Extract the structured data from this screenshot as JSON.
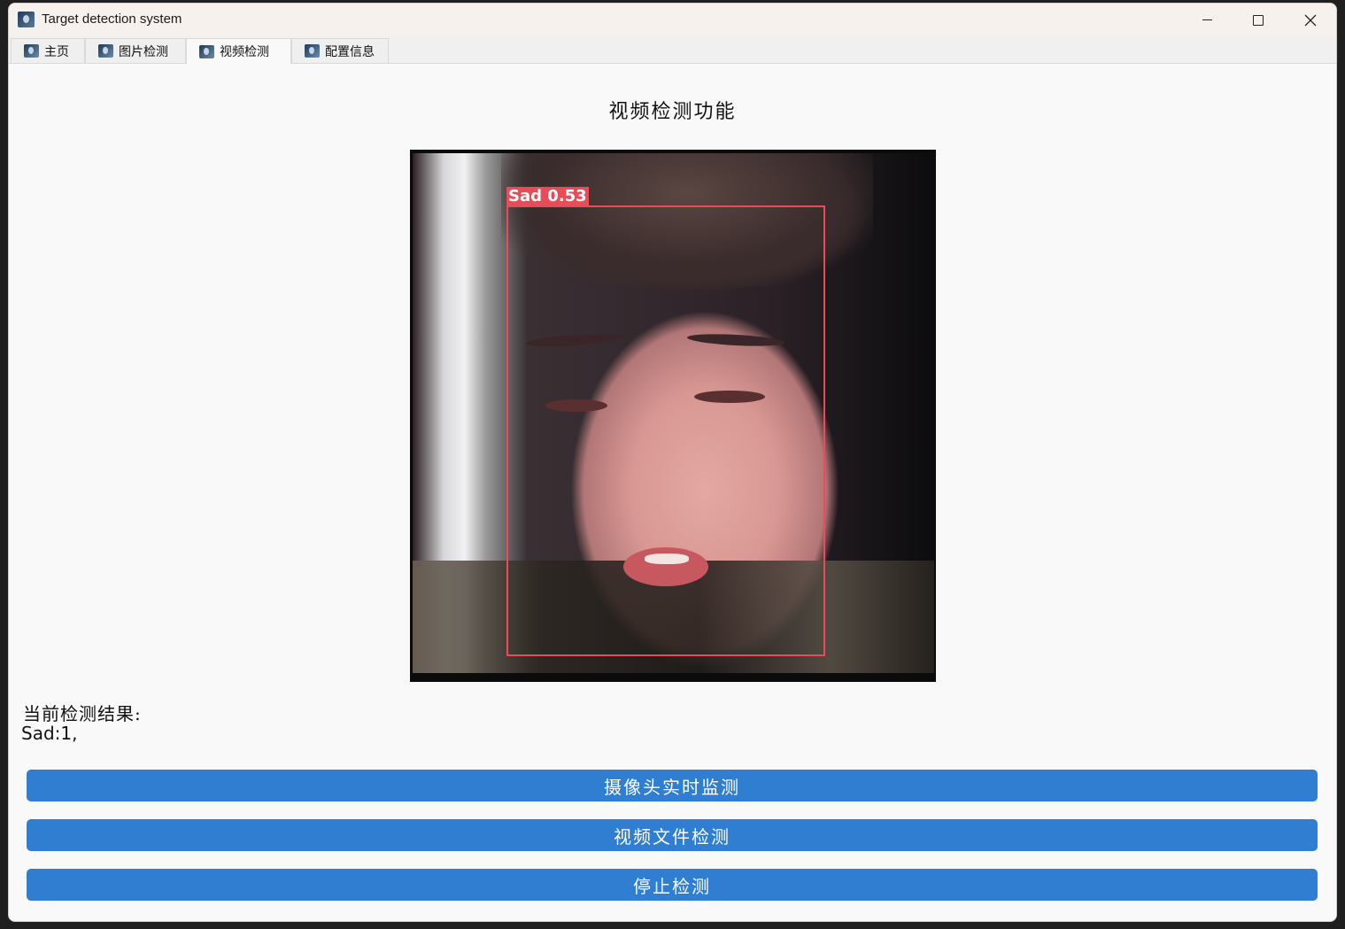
{
  "window": {
    "title": "Target detection system"
  },
  "tabs": [
    {
      "label": "主页",
      "active": false
    },
    {
      "label": "图片检测",
      "active": false
    },
    {
      "label": "视频检测",
      "active": true
    },
    {
      "label": "配置信息",
      "active": false
    }
  ],
  "main": {
    "heading": "视频检测功能",
    "detection_label": "Sad 0.53",
    "result_title": "当前检测结果:",
    "result_value": "Sad:1,"
  },
  "buttons": {
    "camera": "摄像头实时监测",
    "video_file": "视频文件检测",
    "stop": "停止检测"
  },
  "colors": {
    "accent": "#2f7ed1",
    "detection_box": "#e84c57"
  }
}
